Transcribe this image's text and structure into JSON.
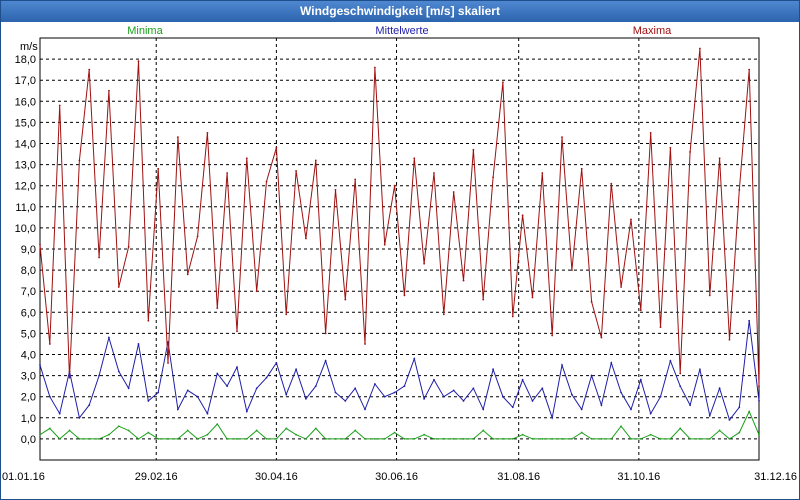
{
  "window": {
    "title": "Windgeschwindigkeit [m/s] skaliert"
  },
  "chart_data": {
    "type": "line",
    "title": "Windgeschwindigkeit [m/s] skaliert",
    "ylabel": "m/s",
    "xlabel": "",
    "ylim": [
      -1,
      19
    ],
    "yticks": [
      0,
      1,
      2,
      3,
      4,
      5,
      6,
      7,
      8,
      9,
      10,
      11,
      12,
      13,
      14,
      15,
      16,
      17,
      18
    ],
    "ytick_labels": [
      "0,0",
      "1,0",
      "2,0",
      "3,0",
      "4,0",
      "5,0",
      "6,0",
      "7,0",
      "8,0",
      "9,0",
      "10,0",
      "11,0",
      "12,0",
      "13,0",
      "14,0",
      "15,0",
      "16,0",
      "17,0",
      "18,0"
    ],
    "x_domain": [
      "2016-01-01",
      "2016-12-31"
    ],
    "xtick_dates": [
      "2016-01-01",
      "2016-02-29",
      "2016-04-30",
      "2016-06-30",
      "2016-08-31",
      "2016-10-31",
      "2016-12-31"
    ],
    "xtick_labels": [
      "01.01.16",
      "29.02.16",
      "30.04.16",
      "30.06.16",
      "31.08.16",
      "31.10.16",
      "31.12.16"
    ],
    "grid": true,
    "legend": "top",
    "series": [
      {
        "name": "Minima",
        "color": "#1aa01a",
        "x": [
          "2016-01-01",
          "2016-01-06",
          "2016-01-11",
          "2016-01-16",
          "2016-01-21",
          "2016-01-26",
          "2016-01-31",
          "2016-02-05",
          "2016-02-10",
          "2016-02-15",
          "2016-02-20",
          "2016-02-25",
          "2016-03-01",
          "2016-03-06",
          "2016-03-11",
          "2016-03-16",
          "2016-03-21",
          "2016-03-26",
          "2016-03-31",
          "2016-04-05",
          "2016-04-10",
          "2016-04-15",
          "2016-04-20",
          "2016-04-25",
          "2016-04-30",
          "2016-05-05",
          "2016-05-10",
          "2016-05-15",
          "2016-05-20",
          "2016-05-25",
          "2016-05-30",
          "2016-06-04",
          "2016-06-09",
          "2016-06-14",
          "2016-06-19",
          "2016-06-24",
          "2016-06-29",
          "2016-07-04",
          "2016-07-09",
          "2016-07-14",
          "2016-07-19",
          "2016-07-24",
          "2016-07-29",
          "2016-08-03",
          "2016-08-08",
          "2016-08-13",
          "2016-08-18",
          "2016-08-23",
          "2016-08-28",
          "2016-09-02",
          "2016-09-07",
          "2016-09-12",
          "2016-09-17",
          "2016-09-22",
          "2016-09-27",
          "2016-10-02",
          "2016-10-07",
          "2016-10-12",
          "2016-10-17",
          "2016-10-22",
          "2016-10-27",
          "2016-11-01",
          "2016-11-06",
          "2016-11-11",
          "2016-11-16",
          "2016-11-21",
          "2016-11-26",
          "2016-12-01",
          "2016-12-06",
          "2016-12-11",
          "2016-12-16",
          "2016-12-21",
          "2016-12-26",
          "2016-12-31"
        ],
        "values": [
          0.2,
          0.5,
          0,
          0.4,
          0,
          0,
          0,
          0.2,
          0.6,
          0.4,
          0,
          0.3,
          0,
          0,
          0,
          0.4,
          0,
          0.2,
          0.7,
          0,
          0,
          0,
          0.4,
          0,
          0,
          0.5,
          0.2,
          0,
          0.5,
          0,
          0,
          0,
          0.4,
          0,
          0,
          0,
          0.3,
          0,
          0,
          0.2,
          0,
          0,
          0,
          0,
          0,
          0.4,
          0,
          0,
          0,
          0.2,
          0,
          0,
          0,
          0,
          0,
          0.3,
          0,
          0,
          0,
          0.6,
          0,
          0,
          0.2,
          0,
          0,
          0.5,
          0,
          0,
          0,
          0.4,
          0,
          0.3,
          1.3,
          0.2
        ]
      },
      {
        "name": "Mittelwerte",
        "color": "#1f1fa8",
        "x": [
          "2016-01-01",
          "2016-01-06",
          "2016-01-11",
          "2016-01-16",
          "2016-01-21",
          "2016-01-26",
          "2016-01-31",
          "2016-02-05",
          "2016-02-10",
          "2016-02-15",
          "2016-02-20",
          "2016-02-25",
          "2016-03-01",
          "2016-03-06",
          "2016-03-11",
          "2016-03-16",
          "2016-03-21",
          "2016-03-26",
          "2016-03-31",
          "2016-04-05",
          "2016-04-10",
          "2016-04-15",
          "2016-04-20",
          "2016-04-25",
          "2016-04-30",
          "2016-05-05",
          "2016-05-10",
          "2016-05-15",
          "2016-05-20",
          "2016-05-25",
          "2016-05-30",
          "2016-06-04",
          "2016-06-09",
          "2016-06-14",
          "2016-06-19",
          "2016-06-24",
          "2016-06-29",
          "2016-07-04",
          "2016-07-09",
          "2016-07-14",
          "2016-07-19",
          "2016-07-24",
          "2016-07-29",
          "2016-08-03",
          "2016-08-08",
          "2016-08-13",
          "2016-08-18",
          "2016-08-23",
          "2016-08-28",
          "2016-09-02",
          "2016-09-07",
          "2016-09-12",
          "2016-09-17",
          "2016-09-22",
          "2016-09-27",
          "2016-10-02",
          "2016-10-07",
          "2016-10-12",
          "2016-10-17",
          "2016-10-22",
          "2016-10-27",
          "2016-11-01",
          "2016-11-06",
          "2016-11-11",
          "2016-11-16",
          "2016-11-21",
          "2016-11-26",
          "2016-12-01",
          "2016-12-06",
          "2016-12-11",
          "2016-12-16",
          "2016-12-21",
          "2016-12-26",
          "2016-12-31"
        ],
        "values": [
          3.5,
          2.0,
          1.2,
          3.2,
          1.0,
          1.6,
          3.0,
          4.8,
          3.2,
          2.4,
          4.5,
          1.8,
          2.2,
          4.6,
          1.4,
          2.3,
          2.0,
          1.2,
          3.1,
          2.5,
          3.4,
          1.3,
          2.4,
          2.9,
          3.6,
          2.1,
          3.3,
          1.9,
          2.5,
          3.7,
          2.2,
          1.8,
          2.4,
          1.4,
          2.6,
          2.0,
          2.2,
          2.5,
          3.8,
          1.9,
          2.8,
          2.0,
          2.3,
          1.8,
          2.4,
          1.4,
          3.3,
          2.0,
          1.5,
          2.8,
          1.8,
          2.4,
          1.0,
          3.5,
          2.1,
          1.4,
          3.0,
          1.6,
          3.6,
          2.2,
          1.4,
          2.8,
          1.2,
          2.0,
          3.7,
          2.5,
          1.6,
          3.3,
          1.1,
          2.4,
          0.9,
          1.5,
          5.6,
          1.8
        ]
      },
      {
        "name": "Maxima",
        "color": "#a01010",
        "x": [
          "2016-01-01",
          "2016-01-06",
          "2016-01-11",
          "2016-01-16",
          "2016-01-21",
          "2016-01-26",
          "2016-01-31",
          "2016-02-05",
          "2016-02-10",
          "2016-02-15",
          "2016-02-20",
          "2016-02-25",
          "2016-03-01",
          "2016-03-06",
          "2016-03-11",
          "2016-03-16",
          "2016-03-21",
          "2016-03-26",
          "2016-03-31",
          "2016-04-05",
          "2016-04-10",
          "2016-04-15",
          "2016-04-20",
          "2016-04-25",
          "2016-04-30",
          "2016-05-05",
          "2016-05-10",
          "2016-05-15",
          "2016-05-20",
          "2016-05-25",
          "2016-05-30",
          "2016-06-04",
          "2016-06-09",
          "2016-06-14",
          "2016-06-19",
          "2016-06-24",
          "2016-06-29",
          "2016-07-04",
          "2016-07-09",
          "2016-07-14",
          "2016-07-19",
          "2016-07-24",
          "2016-07-29",
          "2016-08-03",
          "2016-08-08",
          "2016-08-13",
          "2016-08-18",
          "2016-08-23",
          "2016-08-28",
          "2016-09-02",
          "2016-09-07",
          "2016-09-12",
          "2016-09-17",
          "2016-09-22",
          "2016-09-27",
          "2016-10-02",
          "2016-10-07",
          "2016-10-12",
          "2016-10-17",
          "2016-10-22",
          "2016-10-27",
          "2016-11-01",
          "2016-11-06",
          "2016-11-11",
          "2016-11-16",
          "2016-11-21",
          "2016-11-26",
          "2016-12-01",
          "2016-12-06",
          "2016-12-11",
          "2016-12-16",
          "2016-12-21",
          "2016-12-26",
          "2016-12-31"
        ],
        "values": [
          9.2,
          4.5,
          15.8,
          2.9,
          13.2,
          17.5,
          8.6,
          16.5,
          7.2,
          9.1,
          17.9,
          5.6,
          12.8,
          3.6,
          14.3,
          7.8,
          9.6,
          14.5,
          6.2,
          12.6,
          5.1,
          13.3,
          7.0,
          12.2,
          13.8,
          5.9,
          12.7,
          9.5,
          13.2,
          5.0,
          11.8,
          6.6,
          12.3,
          4.5,
          17.6,
          9.2,
          12.0,
          6.8,
          13.3,
          8.3,
          12.6,
          5.9,
          11.7,
          7.5,
          13.7,
          6.6,
          12.4,
          16.9,
          5.8,
          10.6,
          6.7,
          12.6,
          4.9,
          14.3,
          8.0,
          12.8,
          6.5,
          4.8,
          12.1,
          7.2,
          10.4,
          6.1,
          14.5,
          5.3,
          13.8,
          3.1,
          13.6,
          18.5,
          6.8,
          13.3,
          4.7,
          11.8,
          17.5,
          2.5
        ]
      }
    ]
  }
}
